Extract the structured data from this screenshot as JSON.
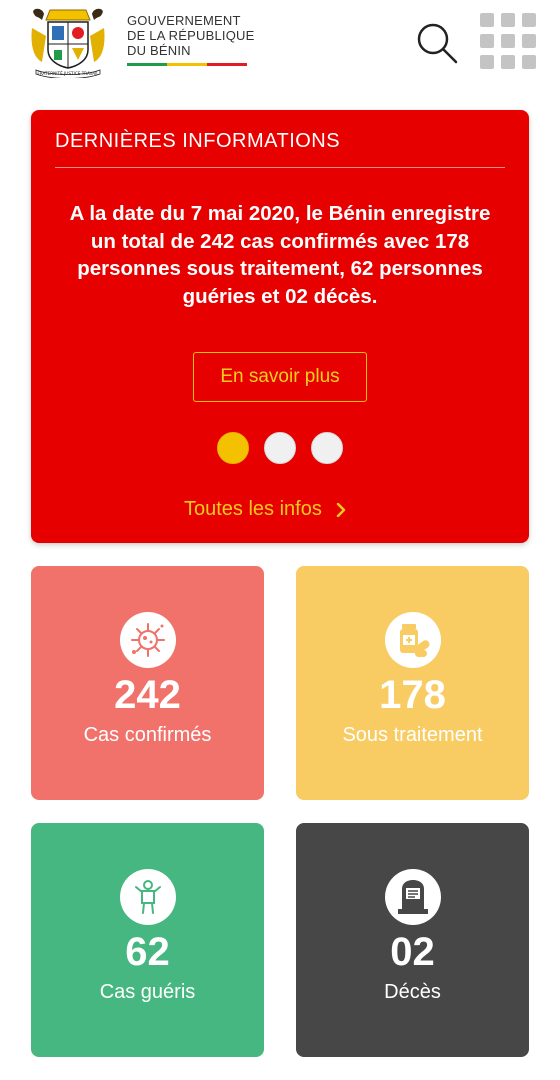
{
  "header": {
    "gov_lines": [
      "GOUVERNEMENT",
      "DE LA RÉPUBLIQUE",
      "DU BÉNIN"
    ],
    "coat_motto": "FRATERNITÉ JUSTICE TRAVAIL",
    "flag_colors": [
      "#1e9c4a",
      "#f3c100",
      "#e31b23"
    ],
    "search_icon": "search-icon",
    "menu_icon": "grid-menu-icon"
  },
  "news": {
    "title": "DERNIÈRES INFORMATIONS",
    "body": "A la date du 7 mai 2020, le Bénin enregistre un total de 242 cas confirmés avec 178 personnes sous traitement, 62 personnes guéries et 02 décès.",
    "more_label": "En savoir plus",
    "all_label": "Toutes les infos",
    "slide_count": 3,
    "active_slide": 1,
    "bg": "#e60000"
  },
  "stats": [
    {
      "value": "242",
      "label": "Cas confirmés",
      "icon": "virus-icon",
      "color": "#f1726a"
    },
    {
      "value": "178",
      "label": "Sous traitement",
      "icon": "medicine-icon",
      "color": "#f9cb63"
    },
    {
      "value": "62",
      "label": "Cas guéris",
      "icon": "recovered-person-icon",
      "color": "#46b780"
    },
    {
      "value": "02",
      "label": "Décès",
      "icon": "tombstone-icon",
      "color": "#474747"
    }
  ]
}
